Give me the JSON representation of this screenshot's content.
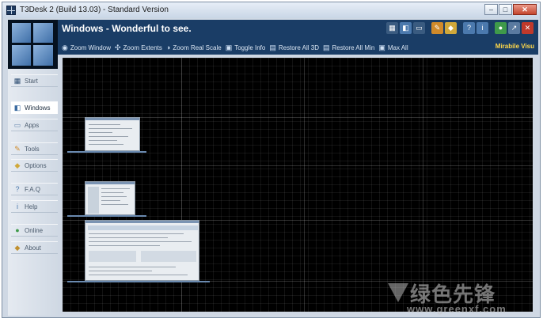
{
  "window": {
    "title": "T3Desk 2 (Build 13.03) - Standard Version",
    "caption_buttons": [
      {
        "name": "minimize-button",
        "glyph": "–"
      },
      {
        "name": "maximize-button",
        "glyph": "□"
      },
      {
        "name": "close-button",
        "glyph": "✕"
      }
    ]
  },
  "header": {
    "title": "Windows - Wonderful to see.",
    "brand": "Mirabile Visu",
    "icons": [
      {
        "name": "layout-icon",
        "glyph": "▦",
        "color": "#3a5b80"
      },
      {
        "name": "windows-view-icon",
        "glyph": "◧",
        "color": "#4b79ad"
      },
      {
        "name": "screen-icon",
        "glyph": "▭",
        "color": "#3a5b80"
      },
      {
        "name": "wrench-icon",
        "glyph": "✎",
        "color": "#d08a2a"
      },
      {
        "name": "options-icon",
        "glyph": "◆",
        "color": "#d0a83a"
      },
      {
        "name": "help-icon",
        "glyph": "?",
        "color": "#4b79ad"
      },
      {
        "name": "info-icon",
        "glyph": "i",
        "color": "#4b79ad"
      },
      {
        "name": "online-icon",
        "glyph": "●",
        "color": "#3f9a4a"
      },
      {
        "name": "pin-icon",
        "glyph": "↗",
        "color": "#5a7aa0"
      },
      {
        "name": "exit-icon",
        "glyph": "✕",
        "color": "#c0392b"
      }
    ]
  },
  "toolbar": [
    {
      "name": "zoom-window",
      "label": "Zoom Window",
      "icon": "◉"
    },
    {
      "name": "zoom-extents",
      "label": "Zoom Extents",
      "icon": "✣"
    },
    {
      "name": "zoom-real-scale",
      "label": "Zoom Real Scale",
      "icon": "◑"
    },
    {
      "name": "toggle-info",
      "label": "Toggle Info",
      "icon": "▣"
    },
    {
      "name": "restore-all-3d",
      "label": "Restore All 3D",
      "icon": "▤"
    },
    {
      "name": "restore-all-min",
      "label": "Restore All Min",
      "icon": "▤"
    },
    {
      "name": "max-all",
      "label": "Max All",
      "icon": "▣"
    }
  ],
  "sidebar": {
    "items": [
      {
        "name": "start",
        "label": "Start",
        "icon": "▦",
        "icon_color": "#2a4a70",
        "active": false
      },
      {
        "name": "windows",
        "label": "Windows",
        "icon": "◧",
        "icon_color": "#3a6aa0",
        "active": true
      },
      {
        "name": "apps",
        "label": "Apps",
        "icon": "▭",
        "icon_color": "#6a8ab0",
        "active": false
      },
      {
        "name": "tools",
        "label": "Tools",
        "icon": "✎",
        "icon_color": "#d08a2a",
        "active": false
      },
      {
        "name": "options",
        "label": "Options",
        "icon": "◆",
        "icon_color": "#d0a83a",
        "active": false
      },
      {
        "name": "faq",
        "label": "F.A.Q",
        "icon": "?",
        "icon_color": "#4b79ad",
        "active": false
      },
      {
        "name": "help",
        "label": "Help",
        "icon": "i",
        "icon_color": "#4b79ad",
        "active": false
      },
      {
        "name": "online",
        "label": "Online",
        "icon": "●",
        "icon_color": "#3f9a4a",
        "active": false
      },
      {
        "name": "about",
        "label": "About",
        "icon": "◆",
        "icon_color": "#c09030",
        "active": false
      }
    ]
  },
  "watermark": {
    "text": "绿色先锋",
    "url": "www.greenxf.com"
  },
  "colors": {
    "header_bg": "#1a3d66",
    "brand": "#ffd84a",
    "canvas_bg": "#000000"
  }
}
